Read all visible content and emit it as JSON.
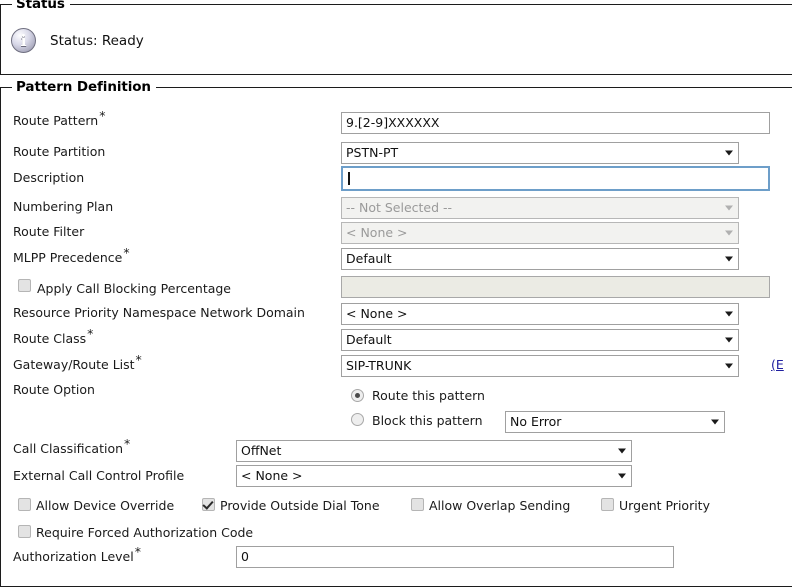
{
  "status_section": {
    "legend": "Status",
    "icon": "info-icon",
    "message": "Status: Ready"
  },
  "pattern_section": {
    "legend": "Pattern Definition",
    "fields": {
      "route_pattern": {
        "label": "Route Pattern",
        "required": "*",
        "value": "9.[2-9]XXXXXX"
      },
      "route_partition": {
        "label": "Route Partition",
        "value": "PSTN-PT"
      },
      "description": {
        "label": "Description",
        "value": ""
      },
      "numbering_plan": {
        "label": "Numbering Plan",
        "value": "-- Not Selected --"
      },
      "route_filter": {
        "label": "Route Filter",
        "value": "< None >"
      },
      "mlpp_precedence": {
        "label": "MLPP Precedence",
        "required": "*",
        "value": "Default"
      },
      "apply_call_blocking_percentage": {
        "label": "Apply Call Blocking Percentage",
        "checked": false,
        "value": ""
      },
      "resource_priority_namespace": {
        "label": "Resource Priority Namespace Network Domain",
        "value": "< None >"
      },
      "route_class": {
        "label": "Route Class",
        "required": "*",
        "value": "Default"
      },
      "gateway_route_list": {
        "label": "Gateway/Route List",
        "required": "*",
        "value": "SIP-TRUNK",
        "edit_link": "(E"
      },
      "route_option": {
        "label": "Route Option",
        "route_this_pattern": "Route this pattern",
        "block_this_pattern": "Block this pattern",
        "selected": "route",
        "block_reason": "No Error"
      },
      "call_classification": {
        "label": "Call Classification",
        "required": "*",
        "value": "OffNet"
      },
      "external_call_control_profile": {
        "label": "External Call Control Profile",
        "value": "< None >"
      },
      "allow_device_override": {
        "label": "Allow Device Override",
        "checked": false
      },
      "provide_outside_dial_tone": {
        "label": "Provide Outside Dial Tone",
        "checked": true
      },
      "allow_overlap_sending": {
        "label": "Allow Overlap Sending",
        "checked": false
      },
      "urgent_priority": {
        "label": "Urgent Priority",
        "checked": false
      },
      "require_forced_authorization_code": {
        "label": "Require Forced Authorization Code",
        "checked": false
      },
      "authorization_level": {
        "label": "Authorization Level",
        "required": "*",
        "value": "0"
      }
    }
  }
}
